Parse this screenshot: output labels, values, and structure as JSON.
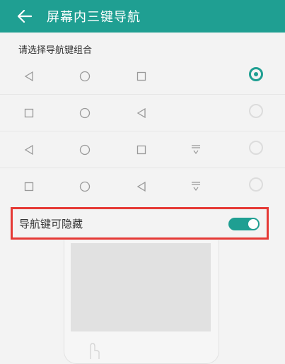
{
  "header": {
    "title": "屏幕内三键导航",
    "back_icon": "back-arrow-icon"
  },
  "nav_combo": {
    "label": "请选择导航键组合",
    "options": [
      {
        "keys": [
          "back-triangle-icon",
          "home-circle-icon",
          "recent-square-icon"
        ],
        "selected": true
      },
      {
        "keys": [
          "recent-square-icon",
          "home-circle-icon",
          "back-triangle-icon"
        ],
        "selected": false
      },
      {
        "keys": [
          "back-triangle-icon",
          "home-circle-icon",
          "recent-square-icon",
          "notification-pull-icon"
        ],
        "selected": false
      },
      {
        "keys": [
          "recent-square-icon",
          "home-circle-icon",
          "back-triangle-icon",
          "notification-pull-icon"
        ],
        "selected": false
      }
    ]
  },
  "hide_nav": {
    "label": "导航键可隐藏",
    "enabled": true
  },
  "colors": {
    "accent": "#1f9f92",
    "highlight_border": "#e53935"
  }
}
